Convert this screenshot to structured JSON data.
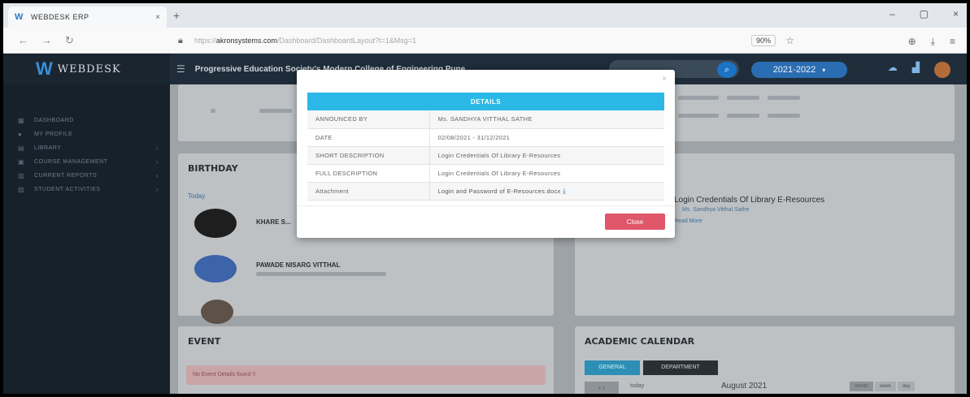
{
  "browser": {
    "tab_title": "WEBDESK ERP",
    "tab_close": "×",
    "new_tab": "+",
    "window_controls": [
      "–",
      "▢",
      "×"
    ],
    "url_prefix": "https://",
    "url_host": "akronsystems.com",
    "url_path": "/Dashboard/DashboardLayout?t=1&Msg=1",
    "zoom": "90%"
  },
  "app": {
    "brand_name": "WEBDESK",
    "institute": "Progressive Education Society's Modern College of Engineering Pune",
    "year": "2021-2022"
  },
  "sidebar": {
    "items": [
      {
        "label": "DASHBOARD",
        "icon": "dashboard-icon",
        "chevron": false
      },
      {
        "label": "MY PROFILE",
        "icon": "user-icon",
        "chevron": false
      },
      {
        "label": "LIBRARY",
        "icon": "book-icon",
        "chevron": true
      },
      {
        "label": "COURSE MANAGEMENT",
        "icon": "course-icon",
        "chevron": true
      },
      {
        "label": "CURRENT REPORTS",
        "icon": "report-icon",
        "chevron": true
      },
      {
        "label": "STUDENT ACTIVITIES",
        "icon": "activity-icon",
        "chevron": true
      }
    ]
  },
  "content": {
    "birthday_title": "BIRTHDAY",
    "birthday_tab": "Today",
    "birthday_people": [
      {
        "name": "KHARE S..."
      },
      {
        "name": "PAWADE NISARG VITTHAL"
      }
    ],
    "event_title": "EVENT",
    "event_empty": "No Event Details found !!",
    "notice_title": "Login Credentials Of Library E-Resources",
    "notice_by": "Ms. Sandhya Vitthal Sathe",
    "notice_more": "Read More",
    "calendar_title": "ACADEMIC CALENDAR",
    "calendar_tabs": [
      "GENERAL",
      "DEPARTMENT"
    ],
    "calendar_month": "August 2021",
    "calendar_today": "today",
    "calendar_views": [
      "month",
      "week",
      "day"
    ]
  },
  "modal": {
    "header": "DETAILS",
    "rows": [
      {
        "key": "ANNOUNCED BY",
        "value": "Ms. SANDHYA VITTHAL SATHE"
      },
      {
        "key": "DATE",
        "value": "02/08/2021 - 31/12/2021"
      },
      {
        "key": "SHORT DESCRIPTION",
        "value": "Login Credentials Of Library E-Resources"
      },
      {
        "key": "FULL DESCRIPTION",
        "value": "Login Credentials Of Library E-Resources"
      },
      {
        "key": "Attachment",
        "value": "Login and Password of E-Resources.docx"
      }
    ],
    "close_label": "Close"
  },
  "colors": {
    "accent": "#2bb8e6",
    "close_button": "#e0566b",
    "sidebar": "#17212b",
    "header": "#1f2d3a"
  }
}
